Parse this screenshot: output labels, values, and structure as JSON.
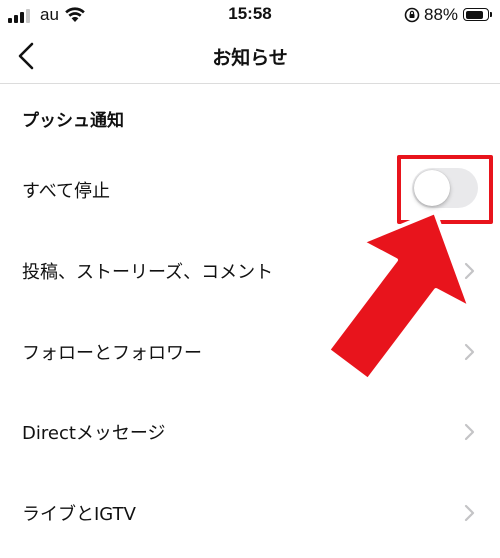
{
  "status_bar": {
    "carrier": "au",
    "time": "15:58",
    "battery_percent": "88%",
    "battery_level": 0.88,
    "signal_bars": 3,
    "signal_bars_total": 4
  },
  "nav": {
    "title": "お知らせ",
    "back_icon": "chevron-left-icon"
  },
  "section": {
    "header": "プッシュ通知"
  },
  "rows": [
    {
      "label": "すべて停止",
      "control": "toggle",
      "toggle_on": false
    },
    {
      "label": "投稿、ストーリーズ、コメント",
      "control": "chevron-right-icon"
    },
    {
      "label": "フォローとフォロワー",
      "control": "chevron-right-icon"
    },
    {
      "label": "Directメッセージ",
      "control": "chevron-right-icon"
    },
    {
      "label": "ライブとIGTV",
      "control": "chevron-right-icon"
    }
  ],
  "annotation": {
    "color": "#e8141c",
    "icons": [
      "highlight-box",
      "pointer-arrow-icon"
    ]
  },
  "colors": {
    "toggle_off_track": "#e9e9eb",
    "chevron": "#c4c4c6",
    "divider": "#dcdcdc"
  }
}
